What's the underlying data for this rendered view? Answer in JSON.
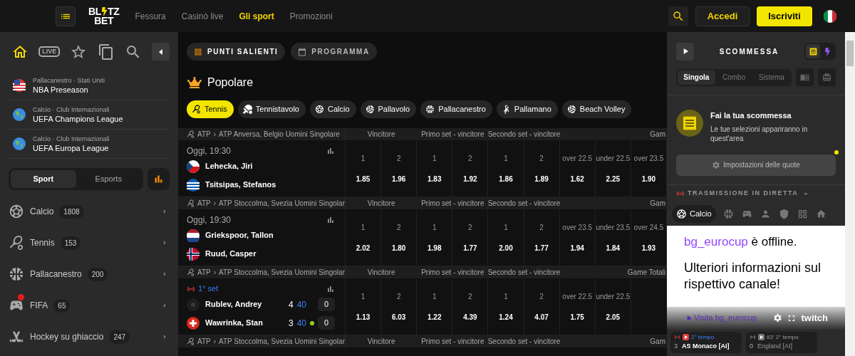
{
  "header": {
    "logo": {
      "top_left": "BL",
      "top_right": "TZ",
      "bottom": "BET"
    },
    "nav": [
      {
        "label": "Fessura",
        "selected": false
      },
      {
        "label": "Casinò live",
        "selected": false
      },
      {
        "label": "Gli sport",
        "selected": true
      },
      {
        "label": "Promozioni",
        "selected": false
      }
    ],
    "login": "Accedi",
    "register": "Iscriviti"
  },
  "sidebar": {
    "quick_nav": [
      {
        "selected": true
      },
      {
        "label": "LIVE",
        "selected": false
      },
      {
        "selected": false
      },
      {
        "selected": false
      },
      {
        "selected": false
      }
    ],
    "leagues": [
      {
        "kind": "us",
        "category": "Pallacanestro · Stati Uniti",
        "name": "NBA Preseason"
      },
      {
        "kind": "globe",
        "category": "Calcio · Club Internazionali",
        "name": "UEFA Champions League"
      },
      {
        "kind": "globe",
        "category": "Calcio · Club Internazionali",
        "name": "UEFA Europa League"
      }
    ],
    "tabs": [
      {
        "label": "Sport",
        "selected": true
      },
      {
        "label": "Esports",
        "selected": false
      }
    ],
    "sports": [
      {
        "name": "Calcio",
        "count": "1808",
        "hot": false
      },
      {
        "name": "Tennis",
        "count": "153",
        "hot": false
      },
      {
        "name": "Pallacanestro",
        "count": "200",
        "hot": false
      },
      {
        "name": "FIFA",
        "count": "65",
        "hot": true
      },
      {
        "name": "Hockey su ghiaccio",
        "count": "247",
        "hot": false
      }
    ]
  },
  "main": {
    "views": [
      {
        "label": "PUNTI SALIENTI",
        "selected": true
      },
      {
        "label": "PROGRAMMA",
        "selected": false
      }
    ],
    "heading": "Popolare",
    "chips": [
      {
        "label": "Tennis",
        "selected": true
      },
      {
        "label": "Tennistavolo",
        "selected": false
      },
      {
        "label": "Calcio",
        "selected": false
      },
      {
        "label": "Pallavolo",
        "selected": false
      },
      {
        "label": "Pallacanestro",
        "selected": false
      },
      {
        "label": "Pallamano",
        "selected": false
      },
      {
        "label": "Beach Volley",
        "selected": false
      }
    ],
    "sections": [
      {
        "category": "ATP",
        "separator": "›",
        "tournament": "ATP Anversa, Belgio Uomini Singolare",
        "markets": [
          "Vincitore",
          "Primo set - vincitore",
          "Secondo set - vincitore",
          "Gam"
        ],
        "match": {
          "live": false,
          "time": "Oggi, 19:30",
          "players": [
            {
              "kind": "cz",
              "name": "Lehecka, Jiri"
            },
            {
              "kind": "gr",
              "name": "Tsitsipas, Stefanos"
            }
          ],
          "odds": [
            {
              "label": "1",
              "value": "1.85"
            },
            {
              "label": "2",
              "value": "1.96"
            },
            {
              "label": "1",
              "value": "1.83"
            },
            {
              "label": "2",
              "value": "1.92"
            },
            {
              "label": "1",
              "value": "1.86"
            },
            {
              "label": "2",
              "value": "1.89"
            },
            {
              "label": "over 22.5",
              "value": "1.62"
            },
            {
              "label": "under 22.5",
              "value": "2.25"
            },
            {
              "label": "over 23.5",
              "value": "1.90"
            }
          ]
        }
      },
      {
        "category": "ATP",
        "separator": "›",
        "tournament": "ATP Stoccolma, Svezia Uomini Singolar",
        "markets": [
          "Vincitore",
          "Primo set - vincitore",
          "Secondo set - vincitore",
          "Gam"
        ],
        "match": {
          "live": false,
          "time": "Oggi, 19:30",
          "players": [
            {
              "kind": "nl",
              "name": "Griekspoor, Tallon"
            },
            {
              "kind": "no",
              "name": "Ruud, Casper"
            }
          ],
          "odds": [
            {
              "label": "1",
              "value": "2.02"
            },
            {
              "label": "2",
              "value": "1.80"
            },
            {
              "label": "1",
              "value": "1.98"
            },
            {
              "label": "2",
              "value": "1.77"
            },
            {
              "label": "1",
              "value": "2.00"
            },
            {
              "label": "2",
              "value": "1.77"
            },
            {
              "label": "over 23.5",
              "value": "1.94"
            },
            {
              "label": "under 23.5",
              "value": "1.84"
            },
            {
              "label": "over 24.5",
              "value": "1.93"
            }
          ]
        }
      },
      {
        "category": "ATP",
        "separator": "›",
        "tournament": "ATP Stoccolma, Svezia Uomini Singolar",
        "markets": [
          "Vincitore",
          "Primo set - vincitore",
          "Secondo set - vincitore",
          "Game Totali"
        ],
        "match": {
          "live": true,
          "time": "1° set",
          "players": [
            {
              "kind": "none",
              "name": "Rublev, Andrey",
              "games": "4",
              "points": "40",
              "serving": false,
              "sets": "0"
            },
            {
              "kind": "ch",
              "name": "Wawrinka, Stan",
              "games": "3",
              "points": "40",
              "serving": true,
              "sets": "0"
            }
          ],
          "odds": [
            {
              "label": "1",
              "value": "1.13"
            },
            {
              "label": "2",
              "value": "6.03"
            },
            {
              "label": "1",
              "value": "1.22"
            },
            {
              "label": "2",
              "value": "4.39"
            },
            {
              "label": "1",
              "value": "1.24"
            },
            {
              "label": "2",
              "value": "4.07"
            },
            {
              "label": "over 22.5",
              "value": "1.75"
            },
            {
              "label": "under 22.5",
              "value": "2.05"
            }
          ]
        }
      },
      {
        "category": "ATP",
        "separator": "›",
        "tournament": "ATP Stoccolma, Svezia Uomini Singolar",
        "markets": [
          "Vincitore",
          "Primo set - vincitore",
          "Secondo set - vincitore",
          "Gam"
        ]
      }
    ]
  },
  "betslip": {
    "title": "SCOMMESSA",
    "modes": [
      {
        "selected": true
      },
      {
        "selected": false
      }
    ],
    "tabs": [
      {
        "label": "Singola",
        "selected": true
      },
      {
        "label": "Combo",
        "selected": false
      },
      {
        "label": "Sistema",
        "selected": false
      }
    ],
    "empty_title": "Fai la tua scommessa",
    "empty_text": "Le tue selezioni appariranno in quest'area",
    "settings": "Impostazioni delle quote",
    "settings_notice": true,
    "stream_title": "TRASMISSIONE IN DIRETTA",
    "stream_sports": [
      {
        "label": "Calcio",
        "selected": true
      },
      {
        "selected": false
      },
      {
        "selected": false
      },
      {
        "selected": false
      },
      {
        "selected": false
      },
      {
        "selected": false
      },
      {
        "selected": false
      }
    ],
    "player": {
      "channel": "bg_eurocup",
      "status": "è offline.",
      "message": "Ulteriori informazioni sul rispettivo canale!",
      "visit": "Visita bg_eurocup",
      "brand": "twitch"
    },
    "live_cards": [
      {
        "active": true,
        "period": "2° tempo",
        "score": "3",
        "team": "AS Monaco [AI]"
      },
      {
        "active": false,
        "period": "83' 2° tempo",
        "score": "0",
        "team": "England [AI]"
      }
    ]
  }
}
